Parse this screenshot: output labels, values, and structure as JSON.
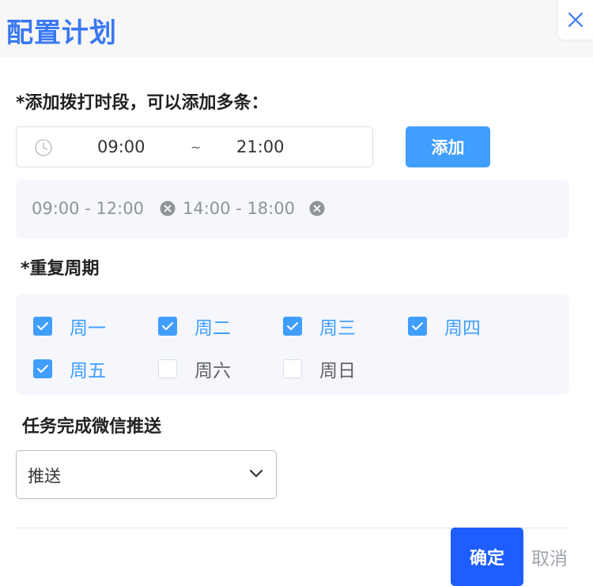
{
  "dialog": {
    "title": "配置计划",
    "close_icon": "close-icon"
  },
  "time_section": {
    "label": "*添加拨打时段，可以添加多条：",
    "start_time": "09:00",
    "separator": "~",
    "end_time": "21:00",
    "add_label": "添加",
    "slots": [
      "09:00 - 12:00",
      "14:00 - 18:00"
    ]
  },
  "repeat_section": {
    "label": "*重复周期",
    "days": [
      {
        "label": "周一",
        "checked": true
      },
      {
        "label": "周二",
        "checked": true
      },
      {
        "label": "周三",
        "checked": true
      },
      {
        "label": "周四",
        "checked": true
      },
      {
        "label": "周五",
        "checked": true
      },
      {
        "label": "周六",
        "checked": false
      },
      {
        "label": "周日",
        "checked": false
      }
    ]
  },
  "push_section": {
    "label": "任务完成微信推送",
    "selected": "推送"
  },
  "footer": {
    "confirm_label": "确定",
    "cancel_label": "取消"
  },
  "colors": {
    "title": "#3a78f2",
    "accent": "#409eff",
    "confirm": "#1e5eff",
    "panel_bg": "#f5f7fd"
  }
}
